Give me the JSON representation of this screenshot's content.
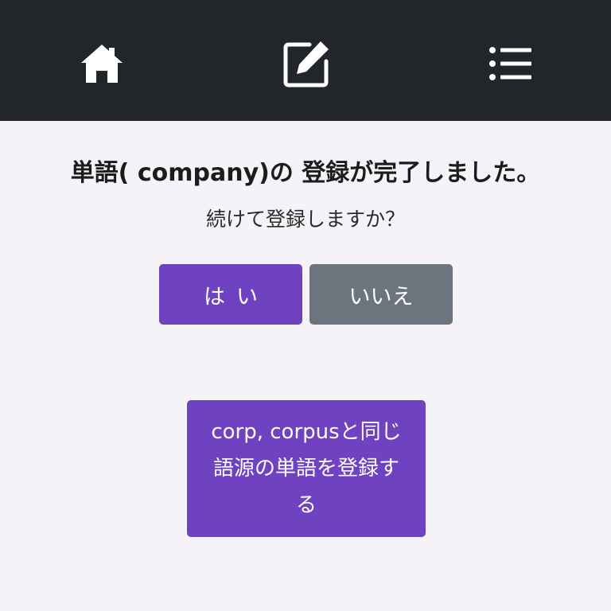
{
  "navbar": {
    "home_icon": "home-icon",
    "edit_icon": "edit-icon",
    "list_icon": "list-icon"
  },
  "main": {
    "title": "単語( company)の 登録が完了しました。",
    "subtitle": "続けて登録しますか？",
    "yes_label": "はい",
    "no_label": "いいえ",
    "etymology_button_label": "corp, corpusと同じ語源の単語を登録する"
  },
  "colors": {
    "navbar_bg": "#222529",
    "primary": "#6f42c1",
    "secondary": "#6c757d",
    "page_bg": "#f5f3f7"
  }
}
